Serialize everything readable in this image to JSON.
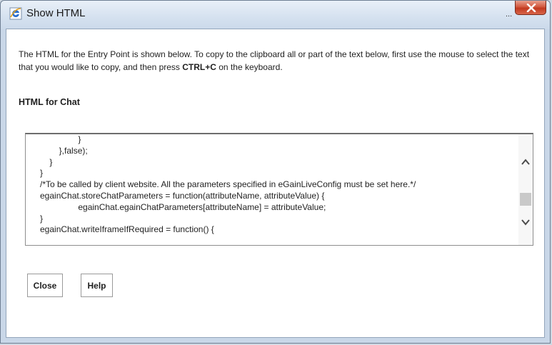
{
  "window": {
    "title": "Show HTML",
    "minimize_label": "...",
    "close_icon": "close-x-icon"
  },
  "intro": {
    "text_before": "The HTML for the Entry Point is shown below. To copy to the clipboard all or part of the text below, first use the mouse to select the text that you would like to copy, and then press ",
    "shortcut": "CTRL+C",
    "text_after": " on the keyboard."
  },
  "section": {
    "title": "HTML for Chat"
  },
  "code": {
    "lines": [
      "                }",
      "        },false);",
      "    }",
      "}",
      "/*To be called by client website. All the parameters specified in eGainLiveConfig must be set here.*/",
      "egainChat.storeChatParameters = function(attributeName, attributeValue) {",
      "                egainChat.egainChatParameters[attributeName] = attributeValue;",
      "}",
      "egainChat.writeIframeIfRequired = function() {"
    ]
  },
  "buttons": {
    "close_label": "Close",
    "help_label": "Help"
  },
  "colors": {
    "titlebar": "#d6e2f0",
    "close_button": "#c23a20",
    "accent_icon": "#2a6fcf"
  }
}
